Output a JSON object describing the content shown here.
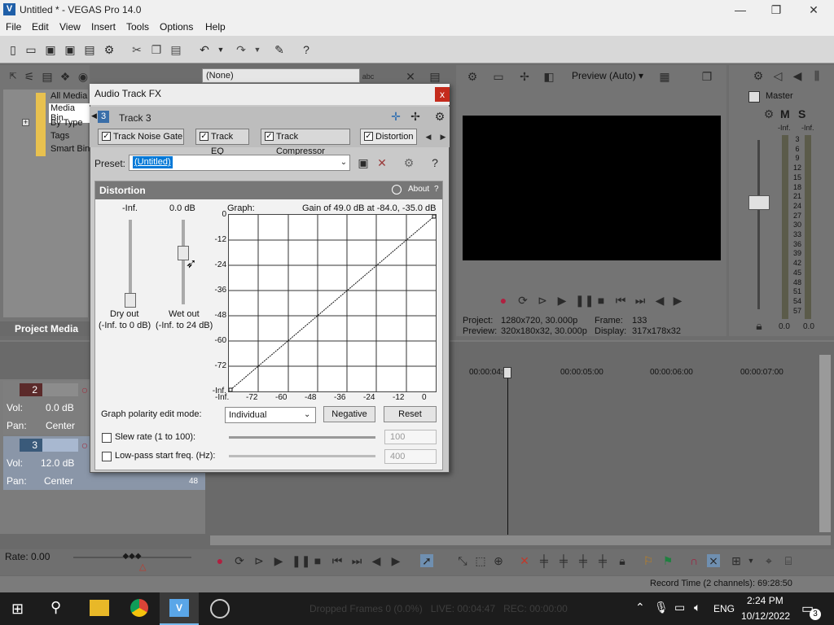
{
  "window": {
    "title": "Untitled * - VEGAS Pro 14.0",
    "minimize": "—",
    "maximize": "❐",
    "close": "✕"
  },
  "menu": [
    "File",
    "Edit",
    "View",
    "Insert",
    "Tools",
    "Options",
    "Help"
  ],
  "project_media": {
    "tree": [
      "All Media",
      "Media Bin",
      "By Type",
      "Tags",
      "Smart Bin"
    ],
    "tab_label": "Project Media"
  },
  "explorer_dropdown": "(None)",
  "preview": {
    "mode": "Preview (Auto)",
    "project_label": "Project:",
    "project_value": "1280x720, 30.000p",
    "preview_label": "Preview:",
    "preview_value": "320x180x32, 30.000p",
    "frame_label": "Frame:",
    "frame_value": "133",
    "display_label": "Display:",
    "display_value": "317x178x32"
  },
  "master": {
    "label": "Master",
    "m": "M",
    "s": "S",
    "left_peak": "-Inf.",
    "right_peak": "-Inf.",
    "scale": [
      "3",
      "6",
      "9",
      "12",
      "15",
      "18",
      "21",
      "24",
      "27",
      "30",
      "33",
      "36",
      "39",
      "42",
      "45",
      "48",
      "51",
      "54",
      "57"
    ],
    "left_level": "0.0",
    "right_level": "0.0"
  },
  "tracks": [
    {
      "number": "2",
      "vol_label": "Vol:",
      "vol": "0.0 dB",
      "pan_label": "Pan:",
      "pan": "Center"
    },
    {
      "number": "3",
      "vol_label": "Vol:",
      "vol": "12.0 dB",
      "pan_label": "Pan:",
      "pan": "Center",
      "fader_value": "48"
    }
  ],
  "timeline": {
    "markers": [
      "00:00:04:",
      "00:00:05:00",
      "00:00:06:00",
      "00:00:07:00"
    ]
  },
  "rate": "Rate: 0.00",
  "record_time": "Record Time (2 channels): 69:28:50",
  "dialog": {
    "title": "Audio Track FX",
    "close": "x",
    "track_number": "3",
    "track_name": "Track 3",
    "chain": [
      {
        "label": "Track Noise Gate",
        "checked": true
      },
      {
        "label": "Track EQ",
        "checked": true
      },
      {
        "label": "Track Compressor",
        "checked": true
      },
      {
        "label": "Distortion",
        "checked": true
      }
    ],
    "preset_label": "Preset:",
    "preset_value": "(Untitled)",
    "plugin": {
      "name": "Distortion",
      "about": "About",
      "help": "?",
      "dry_value": "-Inf.",
      "wet_value": "0.0 dB",
      "dry_label": "Dry out",
      "dry_range": "(-Inf. to 0 dB)",
      "wet_label": "Wet out",
      "wet_range": "(-Inf. to 24 dB)",
      "graph_label": "Graph:",
      "graph_readout": "Gain of 49.0 dB at -84.0, -35.0 dB",
      "y_ticks": [
        "0",
        "-12",
        "-24",
        "-36",
        "-48",
        "-60",
        "-72",
        "-Inf."
      ],
      "x_ticks": [
        "-Inf.",
        "-72",
        "-60",
        "-48",
        "-36",
        "-24",
        "-12",
        "0"
      ],
      "polarity_label": "Graph polarity edit mode:",
      "polarity_value": "Individual",
      "negative_button": "Negative",
      "reset_button": "Reset",
      "slew_label": "Slew rate (1 to 100):",
      "slew_value": "100",
      "lowpass_label": "Low-pass start freq. (Hz):",
      "lowpass_value": "400"
    }
  },
  "taskbar": {
    "status_text": "Dropped Frames 0 (0.0%)   LIVE: 00:04:47   REC: 00:00:00",
    "lang": "ENG",
    "time": "2:24 PM",
    "date": "10/12/2022",
    "notifications": "3"
  }
}
